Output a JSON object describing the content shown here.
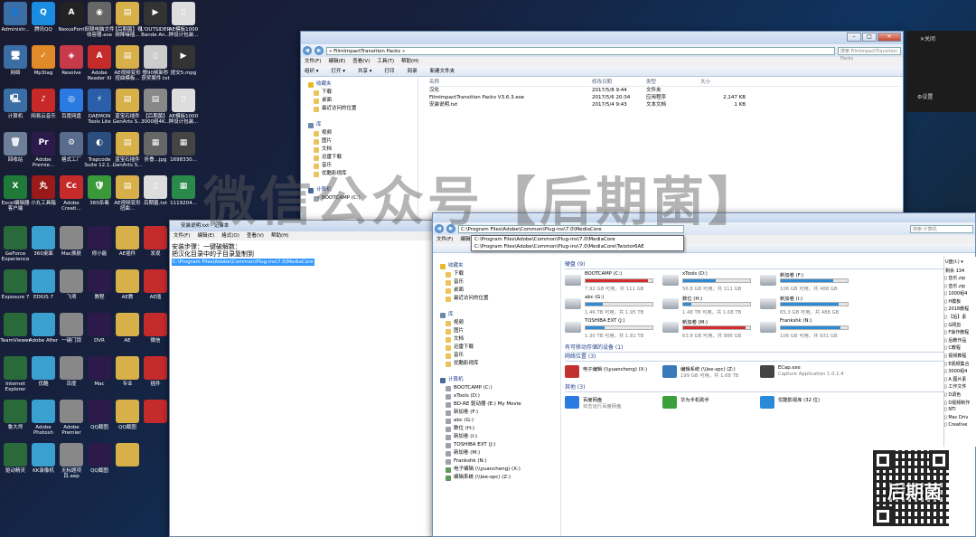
{
  "watermark": "微信公众号【后期菌】",
  "desktop_icons": [
    {
      "label": "Administr...",
      "color": "#3a6ea5",
      "glyph": "👤"
    },
    {
      "label": "腾讯QQ",
      "color": "#1b8de0",
      "glyph": "Q"
    },
    {
      "label": "NexusFont",
      "color": "#222222",
      "glyph": "A"
    },
    {
      "label": "妖颐电脑文件收容器.exe",
      "color": "#666666",
      "glyph": "◉"
    },
    {
      "label": "【后期菌】视频降噪插...",
      "color": "#d8b04a",
      "glyph": "▤"
    },
    {
      "label": "L'OUTSIDER Bande An...",
      "color": "#333333",
      "glyph": "▶"
    },
    {
      "label": "AE模板1000种设计包装...",
      "color": "#dddddd",
      "glyph": "▯"
    },
    {
      "label": "网络",
      "color": "#3a6ea5",
      "glyph": "🖥"
    },
    {
      "label": "Mp3tag",
      "color": "#e08a2a",
      "glyph": "✓"
    },
    {
      "label": "Resolve",
      "color": "#c73a4a",
      "glyph": "◈"
    },
    {
      "label": "Adobe Reader XI",
      "color": "#c62b2b",
      "glyph": "A"
    },
    {
      "label": "AE视频变形扭曲模板...",
      "color": "#d8b04a",
      "glyph": "▤"
    },
    {
      "label": "慢90帧新秒获奖案件.txt",
      "color": "#cccccc",
      "glyph": "▯"
    },
    {
      "label": "提交5.mpg",
      "color": "#333333",
      "glyph": "▶"
    },
    {
      "label": "计算机",
      "color": "#3a6ea5",
      "glyph": "🖳"
    },
    {
      "label": "网易云音乐",
      "color": "#c72828",
      "glyph": "♪"
    },
    {
      "label": "百度网盘",
      "color": "#2a7ae2",
      "glyph": "◎"
    },
    {
      "label": "DAEMON Tools Lite",
      "color": "#2a5ea8",
      "glyph": "⚡"
    },
    {
      "label": "蓝宝石插件 GenArts S...",
      "color": "#d8b04a",
      "glyph": "▤"
    },
    {
      "label": "【后期菌】3000组4K...",
      "color": "#888888",
      "glyph": "▤"
    },
    {
      "label": "AE模板1000种设计包装...",
      "color": "#dddddd",
      "glyph": "▯"
    },
    {
      "label": "回收站",
      "color": "#6d7f99",
      "glyph": "🗑"
    },
    {
      "label": "Adobe Premie...",
      "color": "#2b1a4a",
      "glyph": "Pr"
    },
    {
      "label": "格式工厂",
      "color": "#5a6c8c",
      "glyph": "⚙"
    },
    {
      "label": "Trapcode Suite 12.1...",
      "color": "#2a4e7e",
      "glyph": "◐"
    },
    {
      "label": "蓝宝石插件 GenArts S...",
      "color": "#d8b04a",
      "glyph": "▤"
    },
    {
      "label": "折叠...jpg",
      "color": "#666666",
      "glyph": "▦"
    },
    {
      "label": "1698330...",
      "color": "#444444",
      "glyph": "▦"
    },
    {
      "label": "Excel编辑器客户端",
      "color": "#1f7a3a",
      "glyph": "X"
    },
    {
      "label": "小丸工具箱",
      "color": "#9a1a1a",
      "glyph": "丸"
    },
    {
      "label": "Adobe Creati...",
      "color": "#c62b2b",
      "glyph": "Cc"
    },
    {
      "label": "360杀毒",
      "color": "#3a9a3a",
      "glyph": "🛡"
    },
    {
      "label": "AE视频变形扭曲...",
      "color": "#d8b04a",
      "glyph": "▤"
    },
    {
      "label": "后期菌.txt",
      "color": "#dddddd",
      "glyph": "▯"
    },
    {
      "label": "1119204...",
      "color": "#2a8a4a",
      "glyph": "▦"
    }
  ],
  "notepad": {
    "title": "安装说明.txt - 记事本",
    "menus": [
      "文件(F)",
      "编辑(E)",
      "格式(O)",
      "查看(V)",
      "帮助(H)"
    ],
    "lines": [
      "安装步骤：一键破解数：",
      "把汉化目录中的子目录复制到"
    ],
    "selected_line": "C:\\Program Files\\Adobe\\Common\\Plug-ins\\7.0\\MediaCore"
  },
  "top_window": {
    "title": "FilmImpactTransition Packs",
    "address": "« FilmImpactTransition Packs »",
    "search_placeholder": "搜索 FilmImpactTransition Packs",
    "menus": [
      "文件(F)",
      "编辑(E)",
      "查看(V)",
      "工具(T)",
      "帮助(H)"
    ],
    "toolbar": [
      "组织 ▾",
      "打开 ▾",
      "共享 ▾",
      "打印",
      "刻录",
      "新建文件夹"
    ],
    "nav": [
      {
        "label": "收藏夹",
        "kind": "star",
        "sub": false
      },
      {
        "label": "下载",
        "kind": "folder",
        "sub": true
      },
      {
        "label": "桌面",
        "kind": "folder",
        "sub": true
      },
      {
        "label": "最近访问的位置",
        "kind": "folder",
        "sub": true
      },
      {
        "label": "",
        "kind": "none",
        "sub": false
      },
      {
        "label": "库",
        "kind": "lib",
        "sub": false
      },
      {
        "label": "视频",
        "kind": "folder",
        "sub": true
      },
      {
        "label": "图片",
        "kind": "folder",
        "sub": true
      },
      {
        "label": "文档",
        "kind": "folder",
        "sub": true
      },
      {
        "label": "迅雷下载",
        "kind": "folder",
        "sub": true
      },
      {
        "label": "音乐",
        "kind": "folder",
        "sub": true
      },
      {
        "label": "优酷影视库",
        "kind": "folder",
        "sub": true
      },
      {
        "label": "",
        "kind": "none",
        "sub": false
      },
      {
        "label": "计算机",
        "kind": "pc",
        "sub": false
      },
      {
        "label": "BOOTCAMP (C:)",
        "kind": "drive",
        "sub": true
      }
    ],
    "columns": [
      "名称",
      "修改日期",
      "类型",
      "大小"
    ],
    "files": [
      {
        "name": "汉化",
        "date": "2017/5/8 9:44",
        "type": "文件夹",
        "size": ""
      },
      {
        "name": "FilmImpactTransition Packs V3.6.3.exe",
        "date": "2017/5/6 20:34",
        "type": "应用程序",
        "size": "2,147 KB"
      },
      {
        "name": "安装说明.txt",
        "date": "2017/5/4 9:43",
        "type": "文本文档",
        "size": "1 KB"
      }
    ]
  },
  "computer_window": {
    "address": "C:\\Program Files\\Adobe\\Common\\Plug-ins\\7.0\\MediaCore",
    "autocomplete": [
      "C:\\Program Files\\Adobe\\Common\\Plug-ins\\7.0\\MediaCore",
      "C:\\Program Files\\Adobe\\Common\\Plug-ins\\7.0\\MediaCore\\Twixtor6AE"
    ],
    "search_placeholder": "搜索 计算机",
    "menus": [
      "文件(F)",
      "编辑(E)"
    ],
    "nav": [
      {
        "label": "收藏夹",
        "kind": "star",
        "sub": false
      },
      {
        "label": "下载",
        "kind": "folder",
        "sub": true
      },
      {
        "label": "音乐",
        "kind": "folder",
        "sub": true
      },
      {
        "label": "桌面",
        "kind": "folder",
        "sub": true
      },
      {
        "label": "最近访问的位置",
        "kind": "folder",
        "sub": true
      },
      {
        "label": "",
        "kind": "none",
        "sub": false
      },
      {
        "label": "库",
        "kind": "lib",
        "sub": false
      },
      {
        "label": "视频",
        "kind": "folder",
        "sub": true
      },
      {
        "label": "图片",
        "kind": "folder",
        "sub": true
      },
      {
        "label": "文档",
        "kind": "folder",
        "sub": true
      },
      {
        "label": "迅雷下载",
        "kind": "folder",
        "sub": true
      },
      {
        "label": "音乐",
        "kind": "folder",
        "sub": true
      },
      {
        "label": "优酷影视库",
        "kind": "folder",
        "sub": true
      },
      {
        "label": "",
        "kind": "none",
        "sub": false
      },
      {
        "label": "计算机",
        "kind": "pc",
        "sub": false
      },
      {
        "label": "BOOTCAMP (C:)",
        "kind": "drive",
        "sub": true
      },
      {
        "label": "xTools (D:)",
        "kind": "drive",
        "sub": true
      },
      {
        "label": "BD-RE 驱动器 (E:) My Movie",
        "kind": "drive",
        "sub": true
      },
      {
        "label": "新加卷 (F:)",
        "kind": "drive",
        "sub": true
      },
      {
        "label": "abc (G:)",
        "kind": "drive",
        "sub": true
      },
      {
        "label": "数位 (H:)",
        "kind": "drive",
        "sub": true
      },
      {
        "label": "新加卷 (I:)",
        "kind": "drive",
        "sub": true
      },
      {
        "label": "TOSHIBA EXT (J:)",
        "kind": "drive",
        "sub": true
      },
      {
        "label": "新加卷 (M:)",
        "kind": "drive",
        "sub": true
      },
      {
        "label": "Frankshk (N:)",
        "kind": "drive",
        "sub": true
      },
      {
        "label": "电子编辑 (\\\\yuancheng) (X:)",
        "kind": "net",
        "sub": true
      },
      {
        "label": "编辑系统 (\\\\lee-spc) (Z:)",
        "kind": "net",
        "sub": true
      }
    ],
    "sections": {
      "hard_drives": "硬盘 (9)",
      "removable": "有可移动存储的设备 (1)",
      "network": "网络位置 (3)",
      "other": "其他 (3)"
    },
    "drives": [
      {
        "name": "BOOTCAMP (C:)",
        "free": "7.92 GB 可用，共 111 GB",
        "used_fraction": 0.93,
        "color": "#d42c2c"
      },
      {
        "name": "xTools (D:)",
        "free": "56.8 GB 可用，共 111 GB",
        "used_fraction": 0.49,
        "color": "#2d8bd6"
      },
      {
        "name": "新加卷 (F:)",
        "free": "106 GB 可用，共 488 GB",
        "used_fraction": 0.78,
        "color": "#2d8bd6"
      },
      {
        "name": "abc (G:)",
        "free": "1.46 TB 可用，共 1.95 TB",
        "used_fraction": 0.25,
        "color": "#2d8bd6"
      },
      {
        "name": "数位 (H:)",
        "free": "1.48 TB 可用，共 1.68 TB",
        "used_fraction": 0.12,
        "color": "#2d8bd6"
      },
      {
        "name": "新加卷 (I:)",
        "free": "65.3 GB 可用，共 488 GB",
        "used_fraction": 0.87,
        "color": "#2d8bd6"
      },
      {
        "name": "TOSHIBA EXT (J:)",
        "free": "1.30 TB 可用，共 1.81 TB",
        "used_fraction": 0.28,
        "color": "#2d8bd6"
      },
      {
        "name": "新加卷 (M:)",
        "free": "63.8 GB 可用，共 886 GB",
        "used_fraction": 0.93,
        "color": "#d42c2c"
      },
      {
        "name": "Frankshk (N:)",
        "free": "106 GB 可用，共 931 GB",
        "used_fraction": 0.89,
        "color": "#2d8bd6"
      }
    ],
    "network_items": [
      {
        "line1": "电子编辑 (\\\\yuancheng) (X:)",
        "line2": "",
        "color": "#c23030"
      },
      {
        "line1": "编辑系统 (\\\\lee-spc) (Z:)",
        "line2": "199 GB 可用，共 1.68 TB",
        "color": "#3a7ab8"
      },
      {
        "line1": "ECap.exe",
        "line2": "Capture Application 1.0.1.4",
        "color": "#444444"
      }
    ],
    "other_items": [
      {
        "line1": "百度网盘",
        "line2": "双击运行百度网盘",
        "color": "#2a7ae2"
      },
      {
        "line1": "华为手机助手",
        "line2": "",
        "color": "#3aa03a"
      },
      {
        "line1": "优酷影视库 (32 位)",
        "line2": "",
        "color": "#2a8ad8"
      }
    ]
  },
  "right_panel": {
    "close_label": "关闭",
    "settings_label": "设置",
    "udisk_label": "U盘(I:) ▾",
    "remaining_label": "剩余 134",
    "items": [
      "音乐.zip",
      "音乐.zip",
      "1000组4",
      "H模板",
      "2018教程",
      "【后】素",
      "G网剪",
      "F操作教程",
      "后教作品",
      "C教程",
      "视频教程",
      "E视频集合",
      "3000组4",
      "A 图片素",
      "工作文件",
      "D调色",
      "D视频制作",
      "NTI",
      "Mac Driv",
      "Creative"
    ]
  },
  "qr_caption": "后期菌"
}
